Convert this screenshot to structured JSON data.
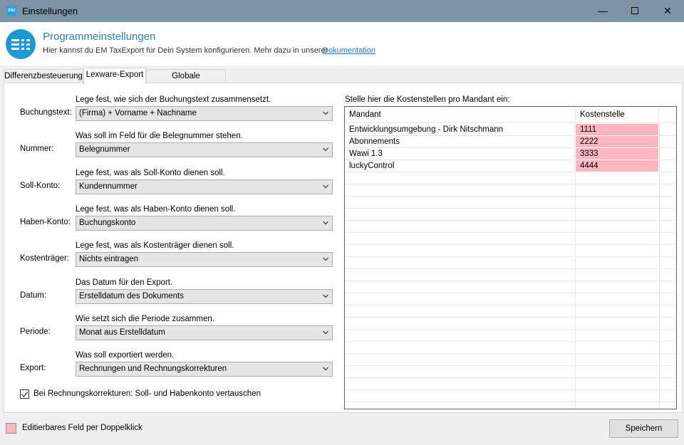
{
  "window": {
    "title": "Einstellungen",
    "icon_text": "ciu",
    "controls": {
      "minimize": "—",
      "close": "✕"
    }
  },
  "header": {
    "title": "Programmeinstellungen",
    "subtitle": "Hier kannst du EM TaxExport für Dein System konfigurieren. Mehr dazu in unserer",
    "link": "Dokumentation"
  },
  "tabs": [
    {
      "label": "Differenzbesteuerung",
      "active": false
    },
    {
      "label": "Lexware-Export",
      "active": true
    },
    {
      "label": "Globale Einstellungen",
      "active": false
    }
  ],
  "fields": [
    {
      "label": "Buchungstext:",
      "hint": "Lege fest, wie sich der Buchungstext zusammensetzt.",
      "value": "(Firma) + Vorname + Nachname"
    },
    {
      "label": "Nummer:",
      "hint": "Was soll im Feld für die Belegnummer stehen.",
      "value": "Belegnummer"
    },
    {
      "label": "Soll-Konto:",
      "hint": "Lege fest, was als Soll-Konto dienen soll.",
      "value": "Kundennummer"
    },
    {
      "label": "Haben-Konto:",
      "hint": "Lege fest, was als Haben-Konto dienen soll.",
      "value": "Buchungskonto"
    },
    {
      "label": "Kostenträger:",
      "hint": "Lege fest, was als Kostenträger dienen soll.",
      "value": "Nichts eintragen"
    },
    {
      "label": "Datum:",
      "hint": "Das Datum für den Export.",
      "value": "Erstelldatum des Dokuments"
    },
    {
      "label": "Periode:",
      "hint": "Wie setzt sich die Periode zusammen.",
      "value": "Monat aus Erstelldatum"
    },
    {
      "label": "Export:",
      "hint": "Was soll exportiert werden.",
      "value": "Rechnungen und Rechnungskorrekturen"
    }
  ],
  "swap_checkbox": {
    "label": "Bei Rechnungskorrekturen: Soll- und Habenkonto vertauschen",
    "checked": true
  },
  "grid": {
    "caption": "Stelle hier die Kostenstellen pro Mandant ein:",
    "columns": [
      "Mandant",
      "Kostenstelle"
    ],
    "rows": [
      {
        "mandant": "Entwicklungsumgebung - Dirk Nitschmann",
        "kostenstelle": "1111"
      },
      {
        "mandant": "Abonnements",
        "kostenstelle": "2222"
      },
      {
        "mandant": "Wawi 1.3",
        "kostenstelle": "3333"
      },
      {
        "mandant": "luckyControl",
        "kostenstelle": "4444"
      }
    ]
  },
  "footer": {
    "legend": "Editierbares Feld per Doppelklick",
    "save": "Speichern"
  },
  "colors": {
    "editable": "#ffb6c1",
    "accent": "#2e7dbd",
    "titlebar": "#7b95a7"
  }
}
